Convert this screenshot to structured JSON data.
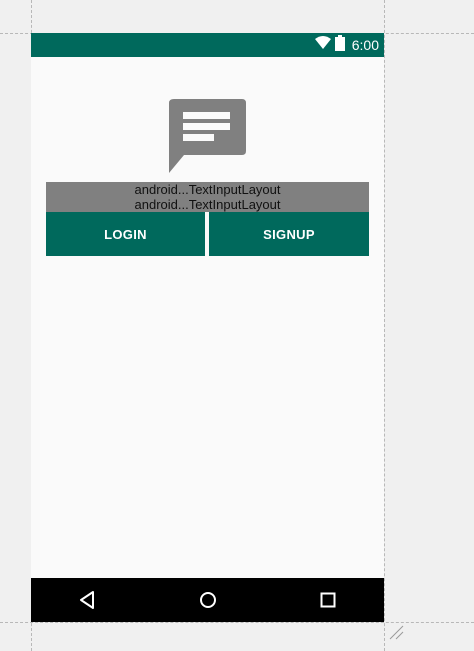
{
  "status_bar": {
    "time": "6:00",
    "color": "#00695c",
    "icons": [
      "wifi-icon",
      "battery-icon"
    ]
  },
  "logo": {
    "icon": "chat-message-icon",
    "color": "#808080"
  },
  "inputs": [
    {
      "label": "android...TextInputLayout"
    },
    {
      "label": "android...TextInputLayout"
    }
  ],
  "buttons": {
    "login_label": "LOGIN",
    "signup_label": "SIGNUP",
    "color": "#00695c"
  },
  "nav_bar": {
    "icons": [
      "back-icon",
      "home-icon",
      "recents-icon"
    ],
    "color": "#000000"
  }
}
